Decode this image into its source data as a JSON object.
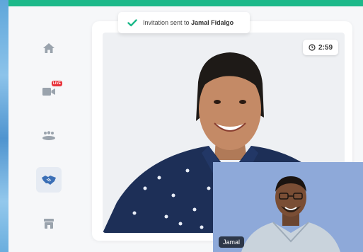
{
  "notification": {
    "prefix": "Invitation sent to",
    "name": "Jamal Fidalgo",
    "icon": "check-icon",
    "accent": "#1db98a"
  },
  "timer": {
    "value": "2:59",
    "icon": "clock-icon"
  },
  "sidebar": {
    "items": [
      {
        "name": "home",
        "icon": "home-icon",
        "active": false
      },
      {
        "name": "live",
        "icon": "video-camera-icon",
        "badge": "LIVE",
        "active": false
      },
      {
        "name": "group",
        "icon": "group-icon",
        "active": false
      },
      {
        "name": "handshake",
        "icon": "handshake-icon",
        "active": true
      },
      {
        "name": "store",
        "icon": "store-icon",
        "active": false
      }
    ]
  },
  "pip": {
    "label": "Jamal"
  },
  "colors": {
    "top_bar": "#1db98a",
    "live_badge": "#e8333b",
    "active_icon": "#3b6fb6",
    "inactive_icon": "#9aa3ad",
    "pip_background": "#8ea9d9"
  }
}
